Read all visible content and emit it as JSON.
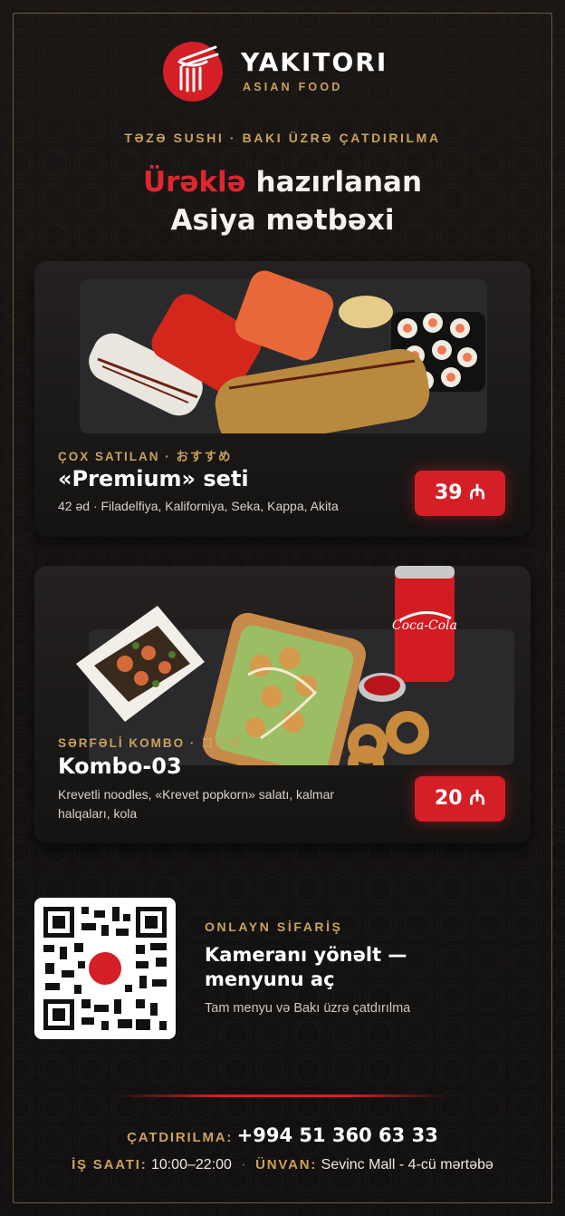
{
  "brand": {
    "name": "YAKITORI",
    "subtitle": "ASIAN FOOD",
    "color": "#d41f26"
  },
  "tagline": "TƏZƏ SUSHI · BAKI ÜZRƏ ÇATDIRILMA",
  "hero": {
    "accent": "Ürəklə",
    "line1_rest": " hazırlanan",
    "line2": "Asiya mətbəxi"
  },
  "products": [
    {
      "kicker": "ÇOX SATILAN · おすすめ",
      "title": "«Premium» seti",
      "description": "42 əd · Filadelfiya, Kaliforniya, Seka, Kappa, Akita",
      "price": "39 ₼"
    },
    {
      "kicker": "SƏRFƏLİ KOMBO · コンボ",
      "title": "Kombo-03",
      "description": "Krevetli noodles, «Krevet popkorn» salatı, kalmar halqaları, kola",
      "price": "20 ₼"
    }
  ],
  "order": {
    "kicker": "ONLAYN SİFARİŞ",
    "title": "Kameranı yönəlt — menyunu aç",
    "description": "Tam menyu və Bakı üzrə çatdırılma"
  },
  "footer": {
    "delivery_label": "ÇATDIRILMA:",
    "phone": "+994 51 360 63 33",
    "hours_label": "İŞ SAATI:",
    "hours": "10:00–22:00",
    "address_label": "ÜNVAN:",
    "address": "Sevinc Mall - 4-cü mərtəbə",
    "separator": "·"
  },
  "colors": {
    "accent": "#d41f26",
    "gold": "#c9a25c",
    "background": "#141110"
  }
}
